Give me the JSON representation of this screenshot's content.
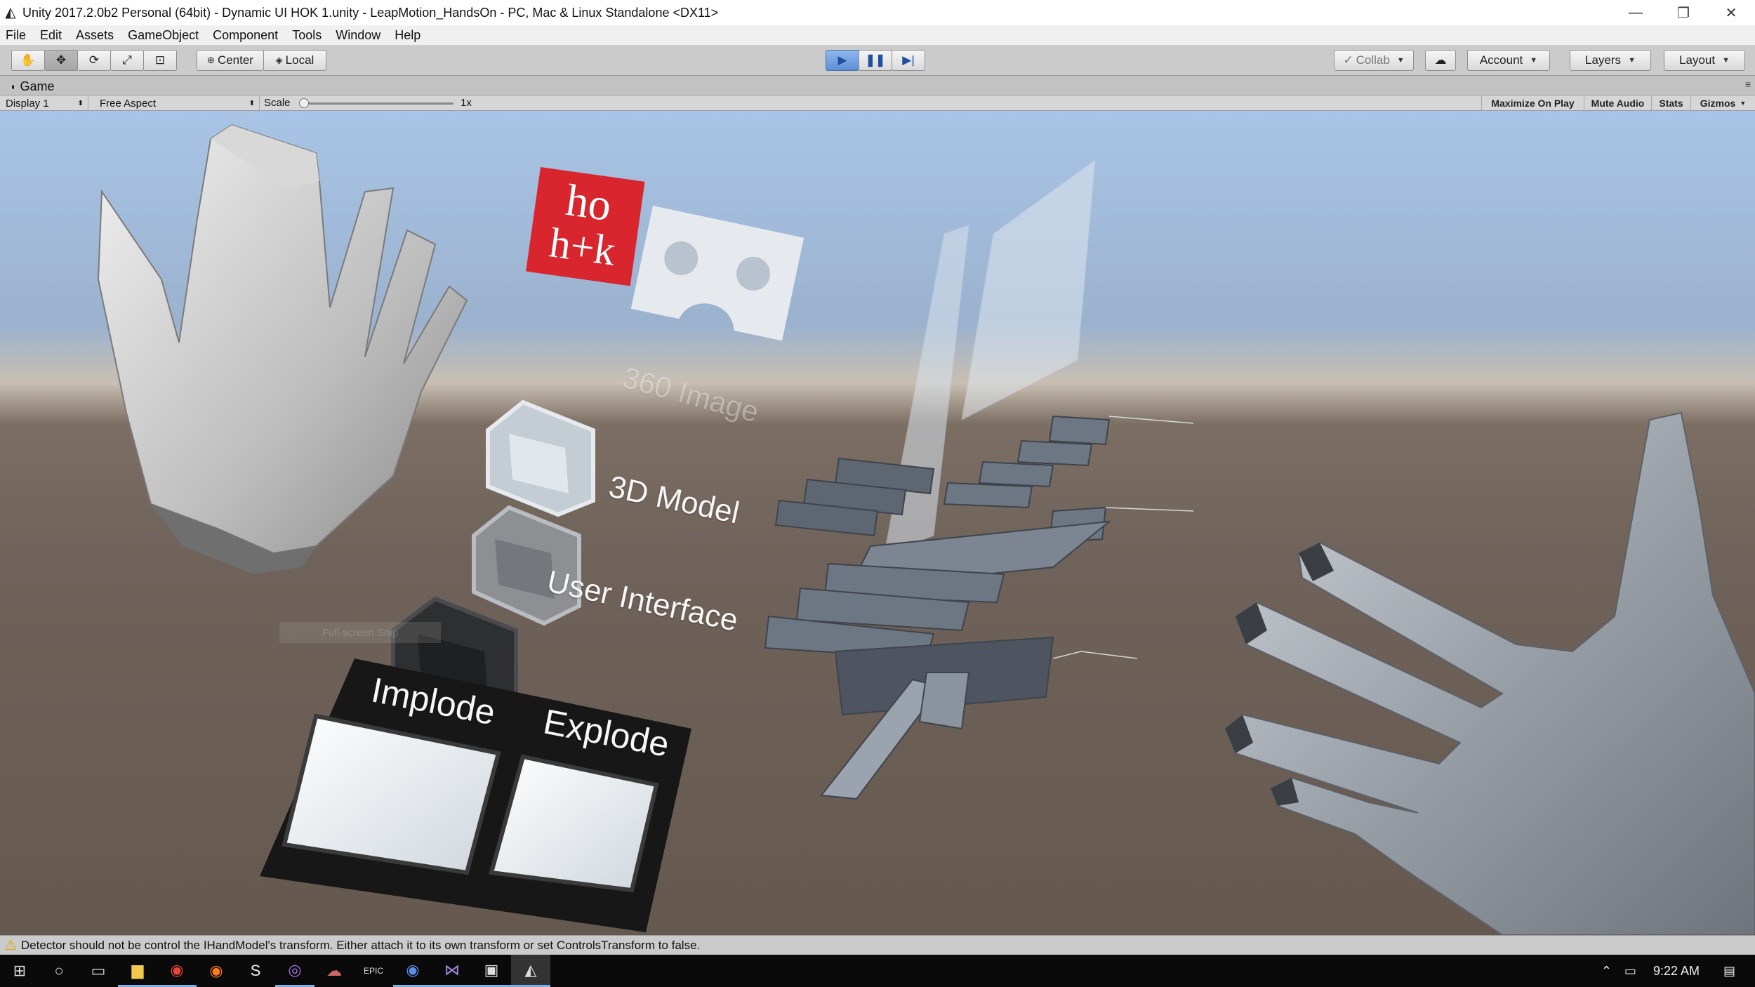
{
  "window": {
    "title": "Unity 2017.2.0b2 Personal (64bit) - Dynamic UI HOK 1.unity - LeapMotion_HandsOn - PC, Mac & Linux Standalone <DX11>",
    "controls": {
      "minimize": "—",
      "restore": "❐",
      "close": "✕"
    }
  },
  "menubar": {
    "items": [
      "File",
      "Edit",
      "Assets",
      "GameObject",
      "Component",
      "Tools",
      "Window",
      "Help"
    ]
  },
  "toolbar": {
    "pivot_label": "Center",
    "space_label": "Local",
    "collab_label": "Collab",
    "account_label": "Account",
    "layers_label": "Layers",
    "layout_label": "Layout",
    "play_state": "playing"
  },
  "game_view": {
    "tab_label": "Game",
    "display_label": "Display 1",
    "aspect_label": "Free Aspect",
    "scale_label": "Scale",
    "scale_value": "1x",
    "maximize_label": "Maximize On Play",
    "mute_label": "Mute Audio",
    "stats_label": "Stats",
    "gizmos_label": "Gizmos"
  },
  "scene": {
    "logo_text_top": "ho",
    "logo_text_bottom": "h+k",
    "label_360": "360 Image",
    "label_3d": "3D Model",
    "label_ui": "User Interface",
    "label_implode": "Implode",
    "label_explode": "Explode",
    "snip_text": "Full-screen Snip",
    "colors": {
      "logo_red": "#d8252e",
      "hand_gray": "#c8c8c8",
      "floor": "#6e625a"
    }
  },
  "console": {
    "message": "Detector should not be control the IHandModel's transform. Either attach it to its own transform or set ControlsTransform to false."
  },
  "taskbar": {
    "clock": "9:22 AM",
    "icons": [
      "windows-start",
      "cortana",
      "task-view",
      "file-explorer",
      "chrome",
      "firefox",
      "sublime",
      "app-purple",
      "app-rocket",
      "epic-launcher",
      "app-blue",
      "visual-studio",
      "app-window",
      "unity"
    ]
  }
}
